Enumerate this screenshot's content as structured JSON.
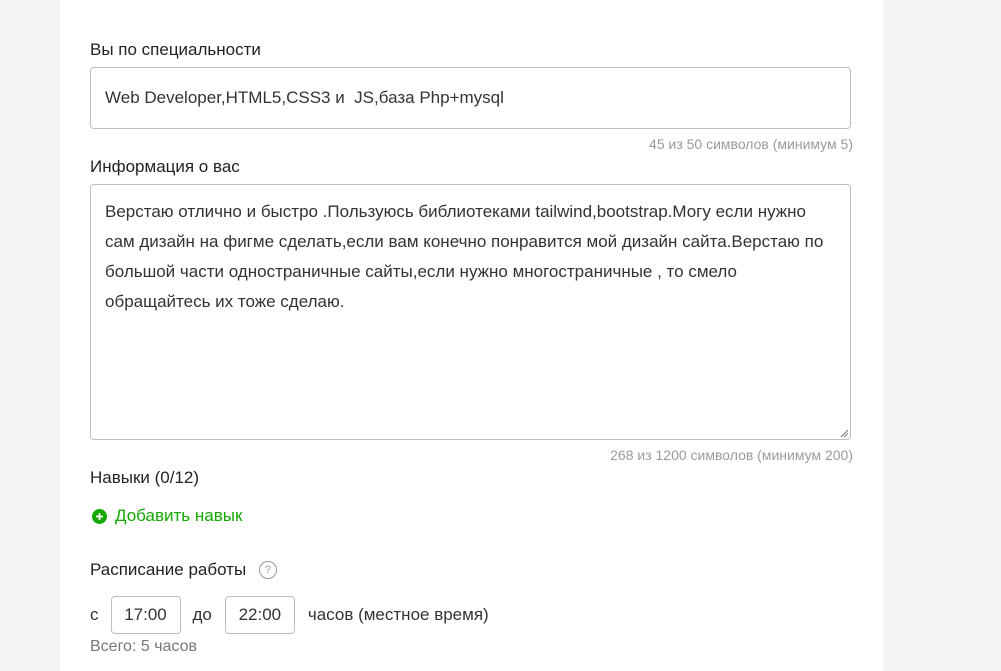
{
  "specialty": {
    "label": "Вы по специальности",
    "value": "Web Developer,HTML5,CSS3 и  JS,база Php+mysql",
    "counter": "45 из 50 символов (минимум 5)"
  },
  "about": {
    "label": "Информация о вас",
    "value": "Верстаю отлично и быстро .Пользуюсь библиотеками tailwind,bootstrap.Могу если нужно сам дизайн на фигме сделать,если вам конечно понравится мой дизайн сайта.Верстаю по большой части одностраничные сайты,если нужно многостраничные , то смело обращайтесь их тоже сделаю.",
    "counter": "268 из 1200 символов (минимум 200)"
  },
  "skills": {
    "label": "Навыки (0/12)",
    "add_label": "Добавить навык",
    "icon": "plus-circle-icon",
    "color": "#14a800"
  },
  "schedule": {
    "label": "Расписание работы",
    "help_icon": "question-circle-icon",
    "help_glyph": "?",
    "from_label": "с",
    "from_value": "17:00",
    "to_label": "до",
    "to_value": "22:00",
    "unit_label": "часов (местное время)",
    "total": "Всего: 5 часов"
  }
}
